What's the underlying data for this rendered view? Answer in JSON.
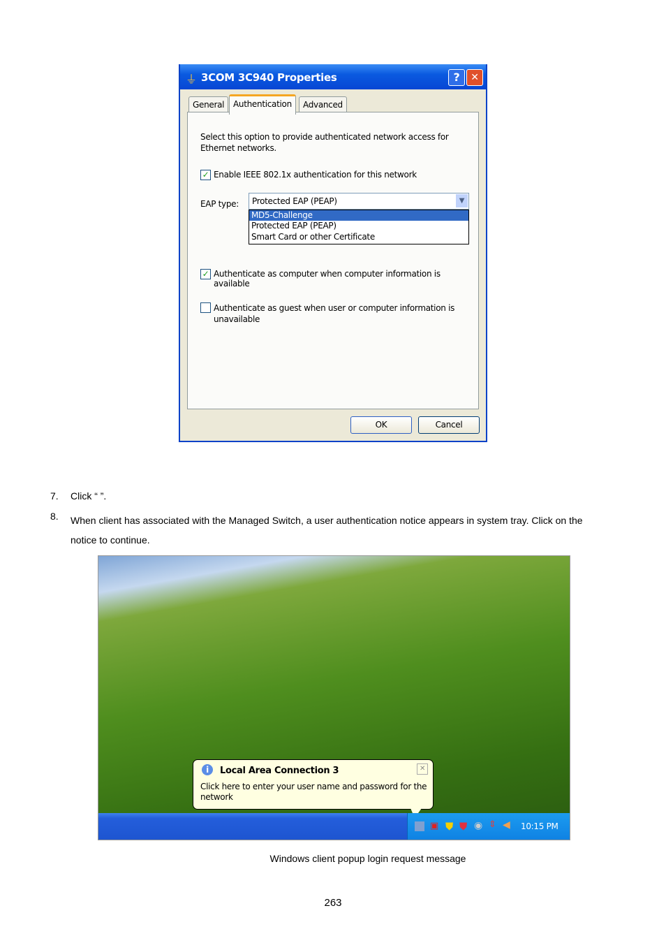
{
  "dialog": {
    "title": "3COM 3C940 Properties",
    "help": "?",
    "close": "✕",
    "tabs": [
      "General",
      "Authentication",
      "Advanced"
    ],
    "description": "Select this option to provide authenticated network access for Ethernet networks.",
    "enable_label": "Enable IEEE 802.1x authentication for this network",
    "enable_checked": true,
    "eap_label": "EAP type:",
    "eap_value": "Protected EAP (PEAP)",
    "eap_options": [
      "MD5-Challenge",
      "Protected EAP (PEAP)",
      "Smart Card or other Certificate"
    ],
    "auth_computer": "Authenticate as computer when computer information is available",
    "auth_computer_checked": true,
    "auth_guest": "Authenticate as guest when user or computer information is unavailable",
    "auth_guest_checked": false,
    "ok": "OK",
    "cancel": "Cancel"
  },
  "steps": [
    {
      "num": "7.",
      "text": "Click “     ”."
    },
    {
      "num": "8.",
      "text": "When client has associated with the Managed Switch, a user authentication notice appears in system tray. Click on the notice to continue."
    }
  ],
  "balloon": {
    "title": "Local Area Connection 3",
    "text": "Click here to enter your user name and password for the network",
    "close": "✕"
  },
  "tray": {
    "clock": "10:15 PM",
    "icons": [
      "network-icon",
      "network-disconnected-icon",
      "security-alert-icon",
      "security-center-icon",
      "update-icon",
      "arrows-icon",
      "volume-icon"
    ]
  },
  "caption": "Windows client popup login request message",
  "page_number": "263"
}
